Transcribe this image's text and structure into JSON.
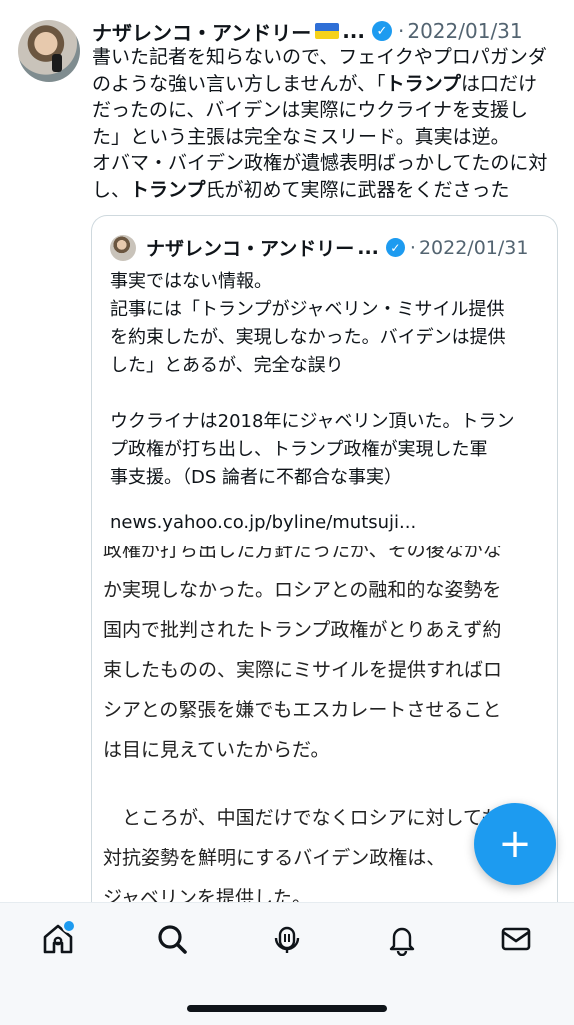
{
  "tweet": {
    "author_name": "ナザレンコ・アンドリー",
    "ellipsis": "...",
    "verified_mark": "✓",
    "separator": "·",
    "date": "2022/01/31",
    "lines": [
      [
        {
          "t": "書いた記者を知らないので、フェイクやプロパガンダ",
          "b": false
        }
      ],
      [
        {
          "t": "のような強い言い方しませんが、「",
          "b": false
        },
        {
          "t": "トランプ",
          "b": true
        },
        {
          "t": "は口だけ",
          "b": false
        }
      ],
      [
        {
          "t": "だったのに、バイデンは実際にウクライナを支援し",
          "b": false
        }
      ],
      [
        {
          "t": "た」という主張は完全なミスリード。真実は逆。",
          "b": false
        }
      ],
      [
        {
          "t": "オバマ・バイデン政権が遺憾表明ばっかしてたのに対",
          "b": false
        }
      ],
      [
        {
          "t": "し、",
          "b": false
        },
        {
          "t": "トランプ",
          "b": true
        },
        {
          "t": "氏が初めて実際に武器をくださった",
          "b": false
        }
      ]
    ]
  },
  "quoted": {
    "author_name": "ナザレンコ・アンドリー",
    "ellipsis": "...",
    "verified_mark": "✓",
    "separator": "·",
    "date": "2022/01/31",
    "lines": [
      "事実ではない情報。",
      "記事には「トランプがジャベリン・ミサイル提供",
      "を約束したが、実現しなかった。バイデンは提供",
      "した」とあるが、完全な誤り",
      "",
      "ウクライナは2018年にジャベリン頂いた。トラン",
      "プ政権が打ち出し、トランプ政権が実現した軍",
      "事支援。（DS 論者に不都合な事実）"
    ],
    "link": "news.yahoo.co.jp/byline/mutsuji..."
  },
  "article_image": {
    "cut_line": "政権が打ち出した方針だったが、その後なかな",
    "para1": [
      "か実現しなかった。ロシアとの融和的な姿勢を",
      "国内で批判されたトランプ政権がとりあえず約",
      "束したものの、実際にミサイルを提供すればロ",
      "シアとの緊張を嫌でもエスカレートさせること",
      "は目に見えていたからだ。"
    ],
    "para2": [
      "　ところが、中国だけでなくロシアに対しても",
      "対抗姿勢を鮮明にするバイデン政権は、",
      "ジャベリンを提供した。"
    ]
  },
  "fab": {
    "label": "+"
  },
  "tabs": [
    {
      "name": "home",
      "icon": "home-icon",
      "has_badge": true
    },
    {
      "name": "search",
      "icon": "search-icon",
      "has_badge": false
    },
    {
      "name": "spaces",
      "icon": "spaces-icon",
      "has_badge": false
    },
    {
      "name": "notifications",
      "icon": "bell-icon",
      "has_badge": false
    },
    {
      "name": "messages",
      "icon": "mail-icon",
      "has_badge": false
    }
  ],
  "colors": {
    "accent": "#1d9bf0",
    "secondary_text": "#536471",
    "text": "#0f1419",
    "flag_blue": "#2f6fd6",
    "flag_yellow": "#f5d21c"
  }
}
